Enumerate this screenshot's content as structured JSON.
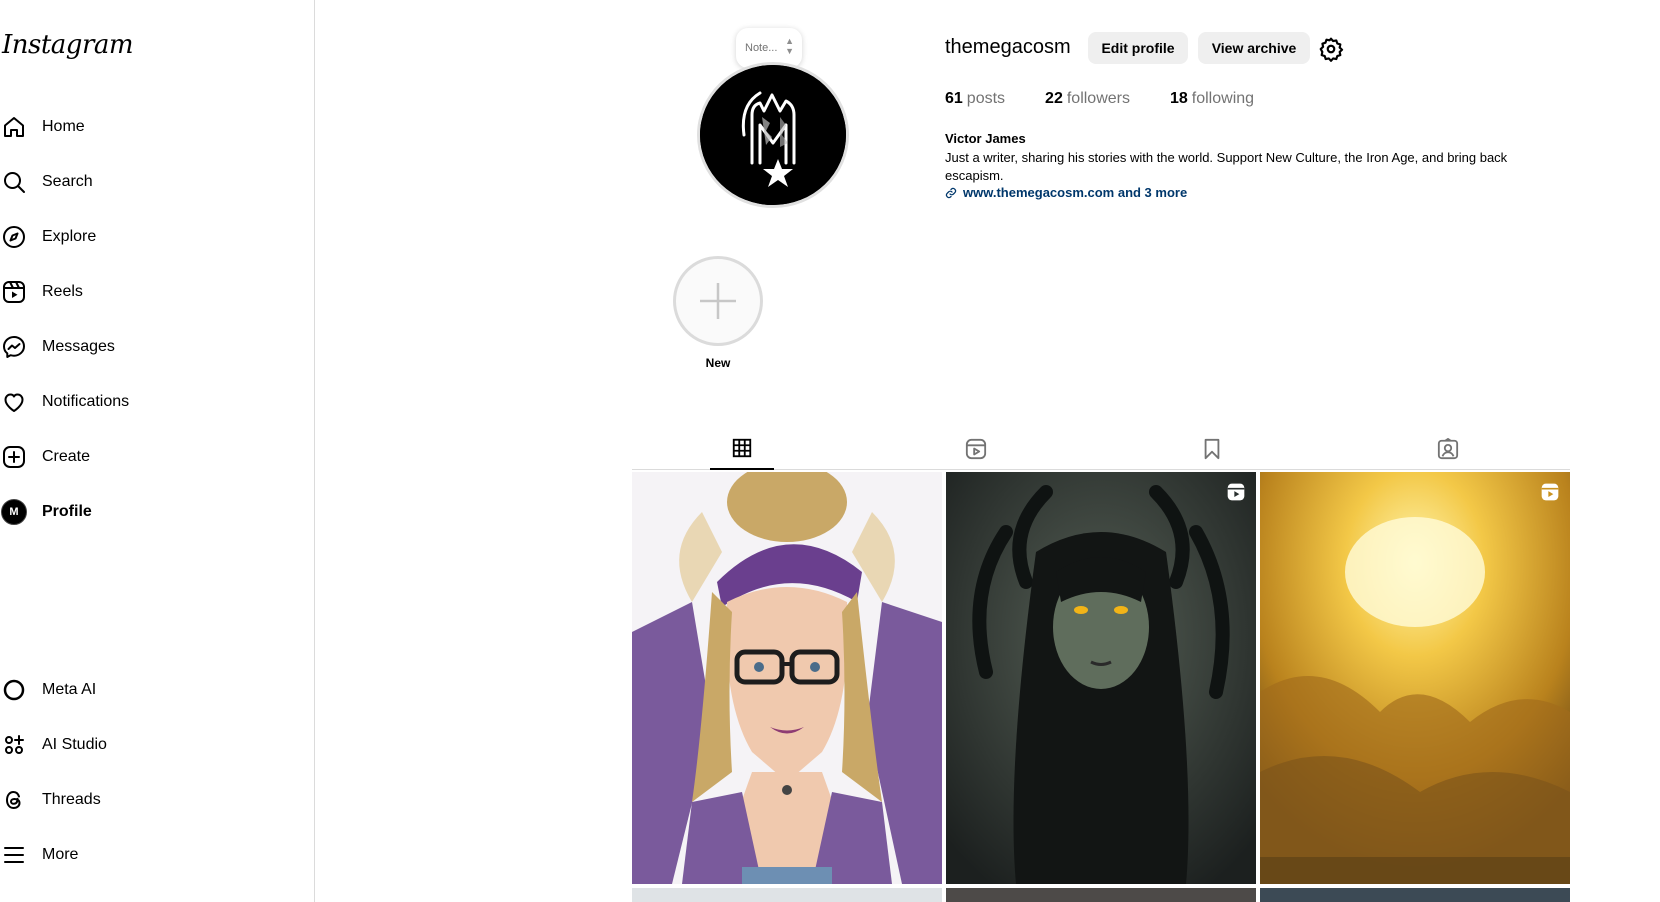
{
  "app": {
    "logo": "Instagram"
  },
  "sidebar": {
    "items": [
      {
        "label": "Home",
        "icon": "home-icon"
      },
      {
        "label": "Search",
        "icon": "search-icon"
      },
      {
        "label": "Explore",
        "icon": "compass-icon"
      },
      {
        "label": "Reels",
        "icon": "reels-icon"
      },
      {
        "label": "Messages",
        "icon": "messenger-icon"
      },
      {
        "label": "Notifications",
        "icon": "heart-icon"
      },
      {
        "label": "Create",
        "icon": "plus-square-icon"
      },
      {
        "label": "Profile",
        "icon": "avatar"
      }
    ],
    "bottom": [
      {
        "label": "Meta AI",
        "icon": "meta-ai-icon"
      },
      {
        "label": "AI Studio",
        "icon": "ai-studio-icon"
      },
      {
        "label": "Threads",
        "icon": "threads-icon"
      },
      {
        "label": "More",
        "icon": "hamburger-icon"
      }
    ]
  },
  "profile": {
    "note_placeholder": "Note...",
    "username": "themegacosm",
    "edit_label": "Edit profile",
    "archive_label": "View archive",
    "stats": {
      "posts_count": "61",
      "posts_label": "posts",
      "followers_count": "22",
      "followers_label": "followers",
      "following_count": "18",
      "following_label": "following"
    },
    "full_name": "Victor James",
    "bio": "Just a writer, sharing his stories with the world. Support New Culture, the Iron Age, and bring back escapism.",
    "link_text": "www.themegacosm.com and 3 more",
    "highlight_new_label": "New"
  },
  "tabs": [
    "grid-icon",
    "reels-icon",
    "bookmark-icon",
    "tagged-icon"
  ],
  "colors": {
    "border": "#dbdbdb",
    "button_bg": "#efefef",
    "muted": "#737373",
    "link": "#00376b"
  }
}
